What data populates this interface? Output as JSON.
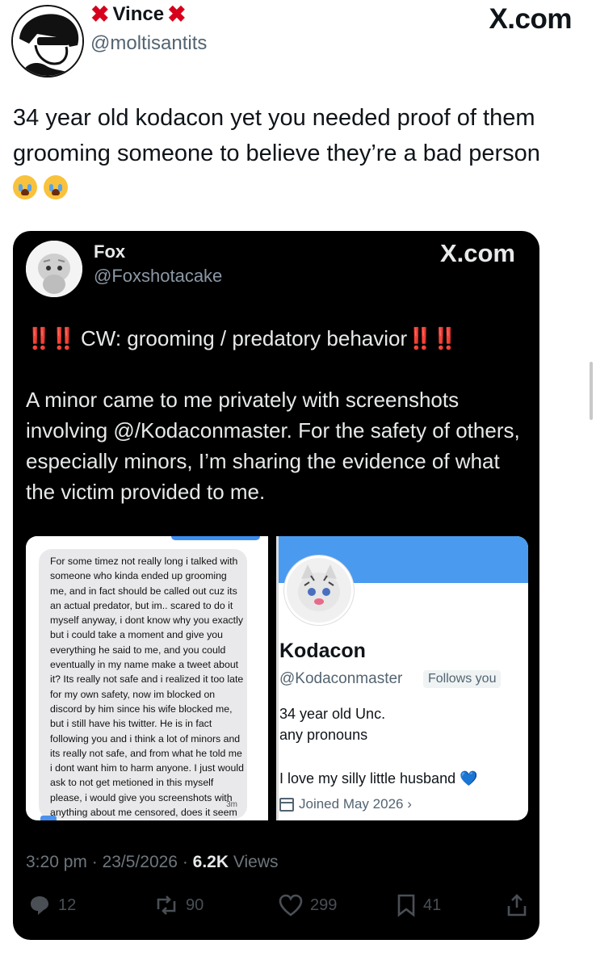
{
  "outer": {
    "display_name": "Vince",
    "handle": "@moltisantits",
    "brand": "X.com",
    "tweet_text": "34 year old kodacon yet you needed proof of them grooming someone to believe they’re a bad person",
    "emoji_icons": [
      "loudly-crying-face-icon",
      "loudly-crying-face-icon"
    ]
  },
  "quoted": {
    "display_name": "Fox",
    "handle": "@Foxshotacake",
    "brand": "X.com",
    "cw_text": "CW: grooming / predatory behavior",
    "bang_marks": "‼️‼️",
    "body": "A minor came to me privately with screenshots involving @/Kodaconmaster. For the safety of others, especially minors, I’m sharing the evidence of what the victim provided to me.",
    "left_screenshot": {
      "message": "For some timez not really long i talked with someone who kinda ended up grooming me, and in fact should be called out cuz its an actual predator, but im.. scared to do it myself anyway, i dont know why you exactly but i could take a moment and give you everything he said to me, and you could eventually in my name make a tweet about it? Its really not safe and i realized it too late for my own safety, now im blocked on discord by him since his wife blocked me, but i still have his twitter. He is in fact following you and i think a lot of minors and its really not safe, and from what he told me i dont want him to harm anyone. I just would ask to not get metioned in this myself please, i would give you screenshots with anything about me censored, does it seem fine?",
      "time": "3m"
    },
    "right_screenshot": {
      "name": "Kodacon",
      "handle": "@Kodaconmaster",
      "follows_badge": "Follows you",
      "bio_line1": "34 year old Unc.",
      "bio_line2": "any pronouns",
      "bio_line3": "I love my silly little husband",
      "bio_emoji": "💙",
      "joined": "Joined May 2026 ›"
    },
    "time": "3:20 pm",
    "date": "23/5/2026",
    "views_count": "6.2K",
    "views_label": "Views",
    "actions": {
      "replies": "12",
      "reposts": "90",
      "likes": "299",
      "bookmarks": "41"
    }
  },
  "colors": {
    "card_bg": "#000000",
    "accent_blue": "#4a9af0",
    "red_x": "#d6001c"
  }
}
